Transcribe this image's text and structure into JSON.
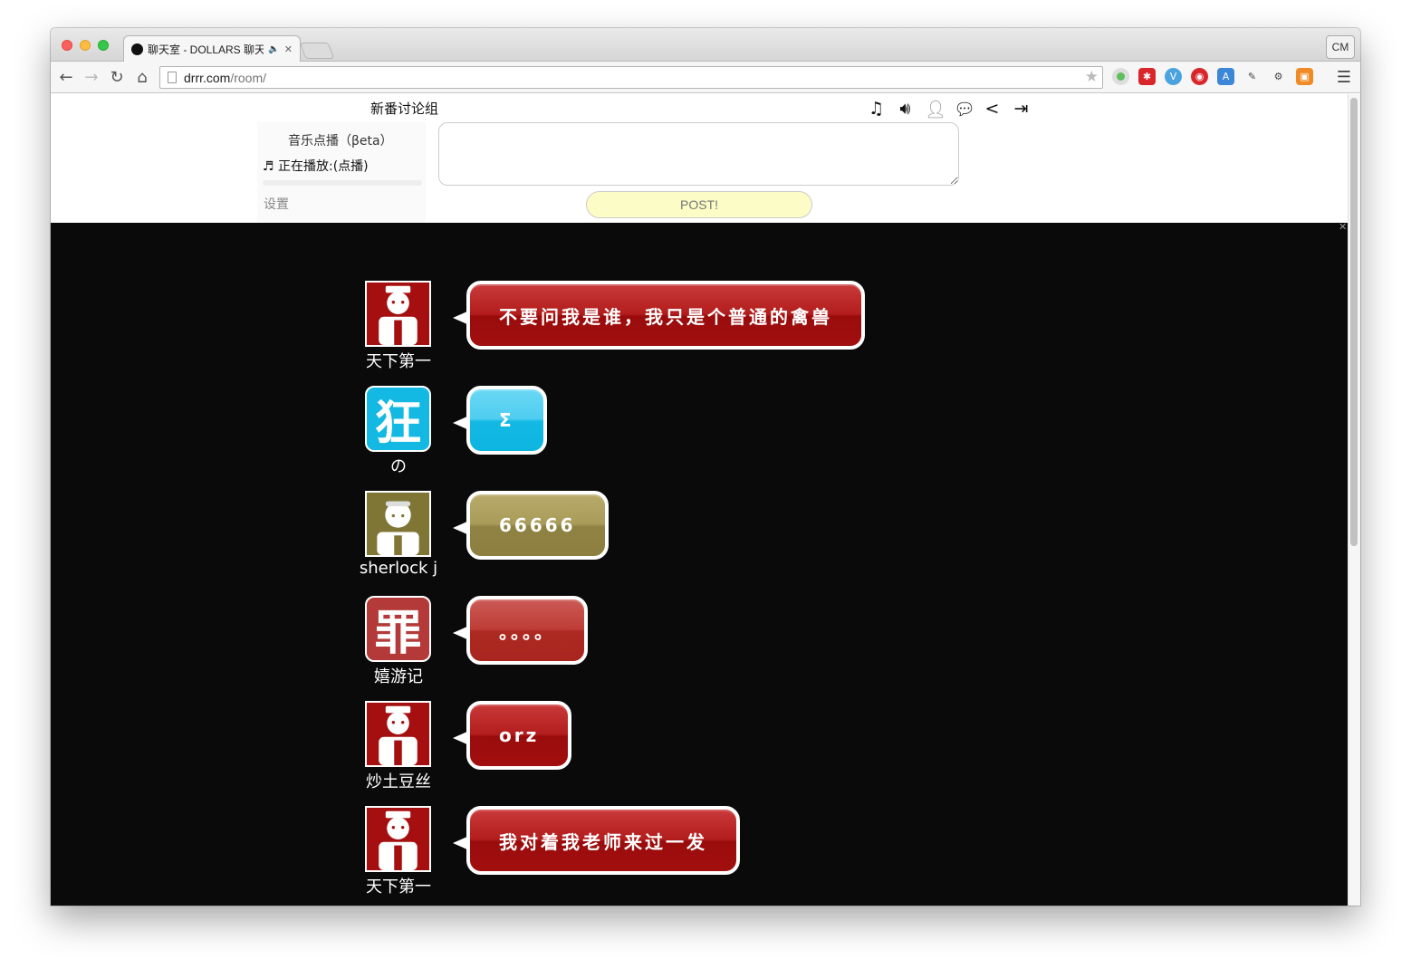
{
  "browser": {
    "tab_title": "聊天室 - DOLLARS 聊天室",
    "tab_audio": "🔈",
    "tab_close": "✕",
    "cm_label": "CM",
    "url_host": "drrr.com",
    "url_path": "/room/"
  },
  "room": {
    "title": "新番讨论组",
    "icons": [
      "music-note-icon",
      "volume-icon",
      "user-icon",
      "chat-icon",
      "share-icon",
      "logout-icon"
    ]
  },
  "music": {
    "title": "音乐点播（βeta）",
    "now_playing": "♬ 正在播放:(点播)",
    "settings": "设置"
  },
  "input": {
    "placeholder": "",
    "post_label": "POST!"
  },
  "messages": [
    {
      "nick": "天下第一",
      "text": "不要问我是谁，我只是个普通的禽兽",
      "avatar": "nurse-red-icon",
      "color": "#a50f0f"
    },
    {
      "nick": "の",
      "text": "Σ",
      "avatar": "kanji-kuang-icon",
      "color": "#13b9e3"
    },
    {
      "nick": "sherlock j",
      "text": "66666",
      "avatar": "person-olive-icon",
      "color": "#8f8243"
    },
    {
      "nick": "嬉游记",
      "text": "。。。。",
      "avatar": "kanji-zui-icon",
      "color": "#ad2a22"
    },
    {
      "nick": "炒土豆丝",
      "text": "orz",
      "avatar": "nurse-red-icon",
      "color": "#a50f0f"
    },
    {
      "nick": "天下第一",
      "text": "我对着我老师来过一发",
      "avatar": "nurse-red-icon",
      "color": "#a50f0f"
    },
    {
      "nick": "",
      "text": "",
      "avatar": "gray-avatar-icon",
      "color": "#a6a6ae"
    }
  ]
}
